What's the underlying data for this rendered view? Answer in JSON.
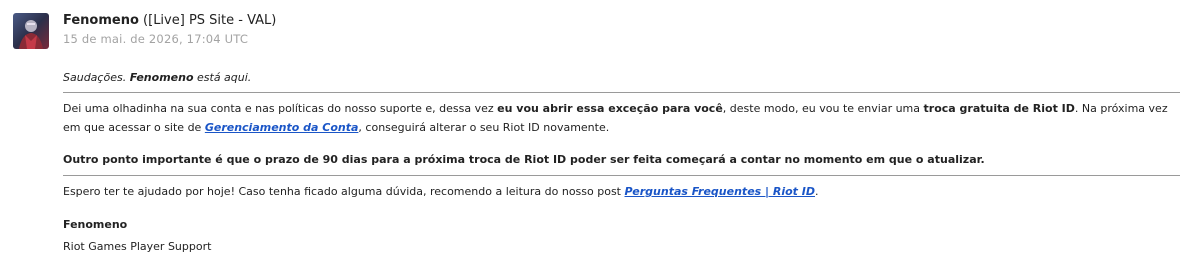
{
  "author": {
    "name": "Fenomeno",
    "group": "([Live] PS Site - VAL)",
    "timestamp": "15 de mai. de 2026, 17:04 UTC"
  },
  "greeting": {
    "prefix": "Saudações. ",
    "name": "Fenomeno",
    "suffix": " está aqui."
  },
  "paragraph1": {
    "t1": "Dei uma olhadinha na sua conta e nas políticas do nosso suporte e, dessa vez ",
    "b1": "eu vou abrir essa exceção para você",
    "t2": ", deste modo, eu vou te enviar uma ",
    "b2": "troca gratuita de Riot ID",
    "t3": ". Na próxima vez em que acessar o site de ",
    "link": "Gerenciamento da Conta",
    "t4": ", conseguirá alterar o seu Riot ID novamente."
  },
  "paragraph2": "Outro ponto importante é  que o prazo de 90 dias para a próxima troca de Riot ID poder ser feita começará a contar no momento em que o atualizar.",
  "paragraph3": {
    "t1": "Espero ter te ajudado por hoje! Caso tenha ficado alguma dúvida, recomendo a leitura do nosso post ",
    "link": "Perguntas Frequentes | Riot ID",
    "t2": "."
  },
  "signature": {
    "name": "Fenomeno",
    "team": "Riot Games Player Support"
  },
  "colors": {
    "link": "#1a55c7",
    "timestamp": "#a3a3a3",
    "rule": "#9a9a9a"
  },
  "icons": {
    "avatar": "agent-avatar"
  }
}
